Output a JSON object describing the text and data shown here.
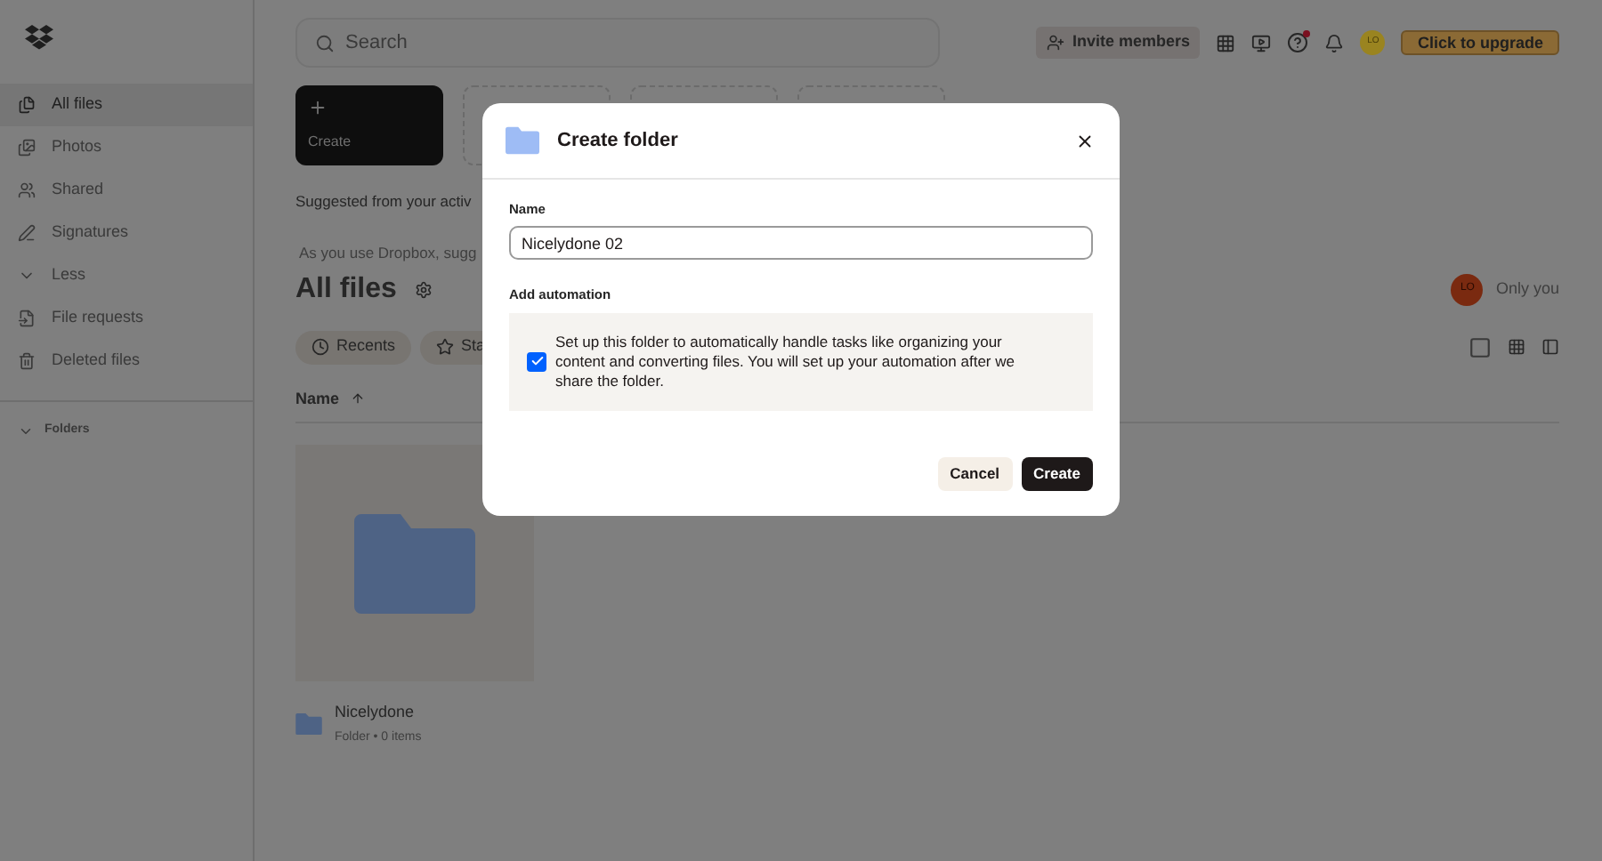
{
  "sidebar": {
    "items": [
      {
        "label": "All files",
        "selected": true
      },
      {
        "label": "Photos",
        "selected": false
      },
      {
        "label": "Shared",
        "selected": false
      },
      {
        "label": "Signatures",
        "selected": false
      },
      {
        "label": "Less",
        "selected": false
      },
      {
        "label": "File requests",
        "selected": false
      },
      {
        "label": "Deleted files",
        "selected": false
      }
    ],
    "section": "Folders"
  },
  "search": {
    "placeholder": "Search"
  },
  "top_bar": {
    "invite": "Invite members",
    "avatar": "LO",
    "upgrade": "Click to upgrade",
    "help_badge": true
  },
  "tiles": [
    {
      "label": "Create",
      "kind": "primary"
    },
    {
      "kind": "dashed"
    },
    {
      "kind": "dashed"
    },
    {
      "kind": "dashed"
    }
  ],
  "suggested": "Suggested from your activ",
  "suggested_hint": "As you use Dropbox, sugg",
  "heading": "All files",
  "sharing": {
    "avatar": "LO",
    "label": "Only you"
  },
  "filters": [
    {
      "label": "Recents"
    },
    {
      "label": "Sta"
    }
  ],
  "table": {
    "column": "Name"
  },
  "items": [
    {
      "name": "Nicelydone",
      "meta": "Folder • 0 items"
    }
  ],
  "dialog": {
    "title": "Create folder",
    "name_label": "Name",
    "name_value": "Nicelydone 02",
    "automation_label": "Add automation",
    "automation_checked": true,
    "automation_text": "Set up this folder to automatically handle tasks like organizing your content and converting files. You will set up your automation after we share the folder.",
    "buttons": [
      {
        "label": "Cancel",
        "kind": "secondary"
      },
      {
        "label": "Create",
        "kind": "primary"
      }
    ]
  }
}
